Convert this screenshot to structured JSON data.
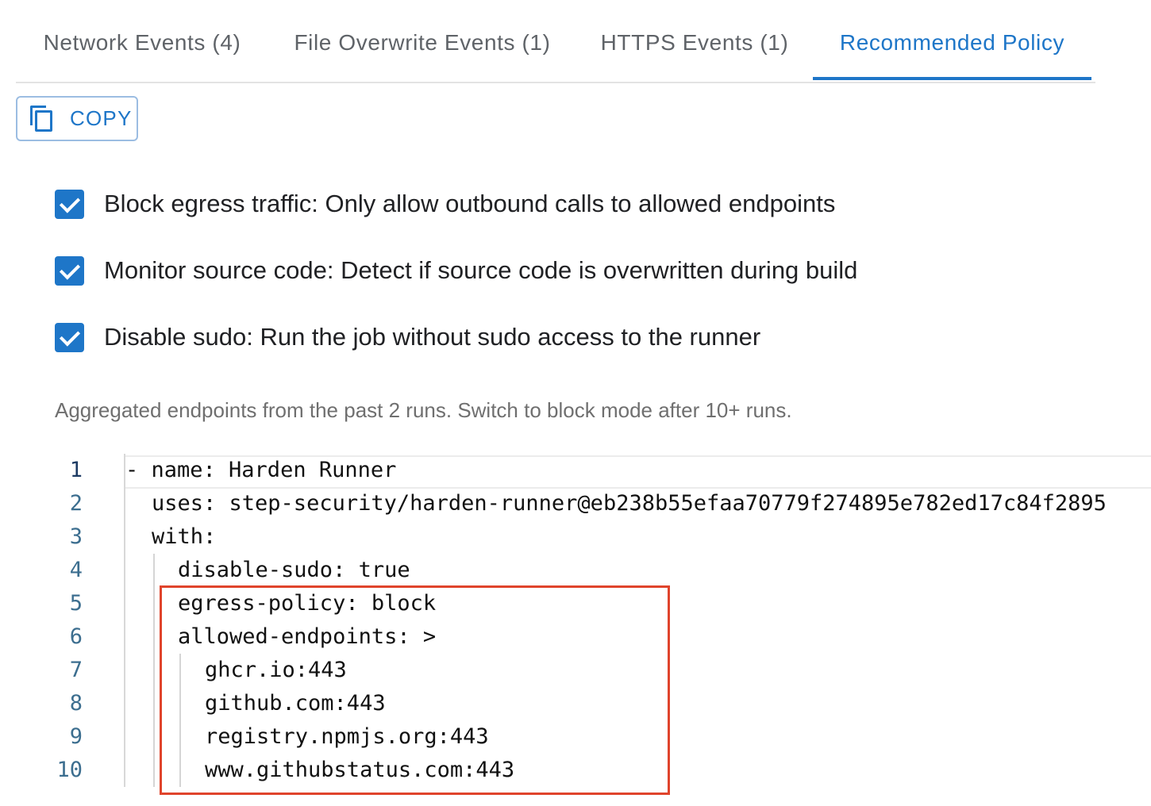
{
  "tabs": [
    {
      "label": "Network Events (4)",
      "active": false
    },
    {
      "label": "File Overwrite Events (1)",
      "active": false
    },
    {
      "label": "HTTPS Events (1)",
      "active": false
    },
    {
      "label": "Recommended Policy",
      "active": true
    }
  ],
  "copy_button": {
    "label": "COPY",
    "icon": "copy-icon"
  },
  "options": [
    {
      "label": "Block egress traffic: Only allow outbound calls to allowed endpoints",
      "checked": true
    },
    {
      "label": "Monitor source code: Detect if source code is overwritten during build",
      "checked": true
    },
    {
      "label": "Disable sudo: Run the job without sudo access to the runner",
      "checked": true
    }
  ],
  "note": "Aggregated endpoints from the past 2 runs. Switch to block mode after 10+ runs.",
  "code": {
    "line_numbers": [
      "1",
      "2",
      "3",
      "4",
      "5",
      "6",
      "7",
      "8",
      "9",
      "10"
    ],
    "lines": [
      "- name: Harden Runner",
      "uses: step-security/harden-runner@eb238b55efaa70779f274895e782ed17c84f2895",
      "with:",
      "disable-sudo: true",
      "egress-policy: block",
      "allowed-endpoints: >",
      "ghcr.io:443",
      "github.com:443",
      "registry.npmjs.org:443",
      "www.githubstatus.com:443"
    ]
  },
  "colors": {
    "accent": "#1e76c8",
    "highlight_border": "#e0442c"
  }
}
